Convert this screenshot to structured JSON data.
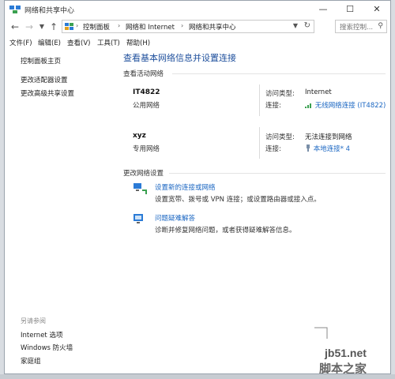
{
  "window": {
    "title": "网络和共享中心"
  },
  "address": {
    "crumbs": [
      "控制面板",
      "网络和 Internet",
      "网络和共享中心"
    ],
    "search_placeholder": "搜索控制..."
  },
  "menu": [
    "文件(F)",
    "编辑(E)",
    "查看(V)",
    "工具(T)",
    "帮助(H)"
  ],
  "sidebar": {
    "links": [
      "控制面板主页",
      "更改适配器设置",
      "更改高级共享设置"
    ],
    "see_also_title": "另请参阅",
    "see_also": [
      "Internet 选项",
      "Windows 防火墙",
      "家庭组"
    ]
  },
  "main": {
    "heading": "查看基本网络信息并设置连接",
    "active_title": "查看活动网络",
    "networks": [
      {
        "name": "IT4822",
        "category": "公用网络",
        "access_label": "访问类型:",
        "access_value": "Internet",
        "conn_label": "连接:",
        "conn_value": "无线网络连接 (IT4822)"
      },
      {
        "name": "xyz",
        "category": "专用网络",
        "access_label": "访问类型:",
        "access_value": "无法连接到网络",
        "conn_label": "连接:",
        "conn_value": "本地连接* 4"
      }
    ],
    "change_title": "更改网络设置",
    "tasks": [
      {
        "link": "设置新的连接或网络",
        "desc": "设置宽带、拨号或 VPN 连接；或设置路由器或接入点。"
      },
      {
        "link": "问题疑难解答",
        "desc": "诊断并修复网络问题，或者获得疑难解答信息。"
      }
    ]
  },
  "watermark": {
    "url": "jb51.net",
    "text": "脚本之家"
  }
}
